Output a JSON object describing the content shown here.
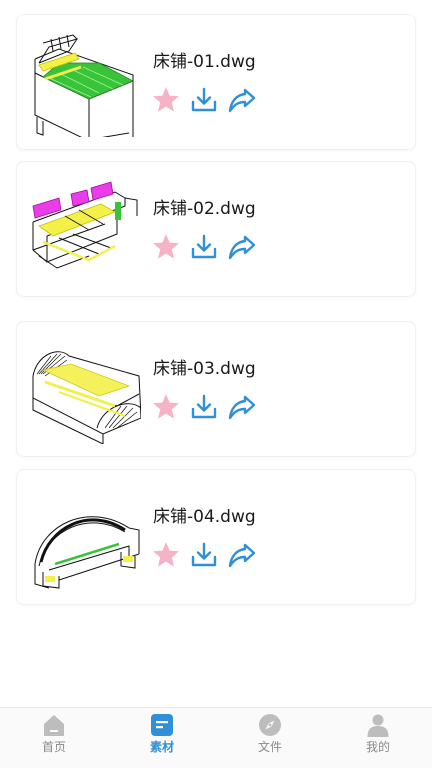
{
  "files": [
    {
      "name": "床铺-01.dwg",
      "thumb": "bed-cad-green"
    },
    {
      "name": "床铺-02.dwg",
      "thumb": "bed-cad-magenta"
    },
    {
      "name": "床铺-03.dwg",
      "thumb": "bed-cad-fan"
    },
    {
      "name": "床铺-04.dwg",
      "thumb": "bed-cad-arch"
    }
  ],
  "actions": {
    "favorite_icon": "star-icon",
    "download_icon": "download-icon",
    "share_icon": "share-icon"
  },
  "tabbar": {
    "items": [
      {
        "label": "首页",
        "icon": "home-icon",
        "active": false
      },
      {
        "label": "素材",
        "icon": "material-icon",
        "active": true
      },
      {
        "label": "文件",
        "icon": "compass-icon",
        "active": false
      },
      {
        "label": "我的",
        "icon": "user-icon",
        "active": false
      }
    ]
  },
  "colors": {
    "accent": "#2f8fd8",
    "star": "#f7b3c6",
    "inactive": "#b8b8b8"
  }
}
